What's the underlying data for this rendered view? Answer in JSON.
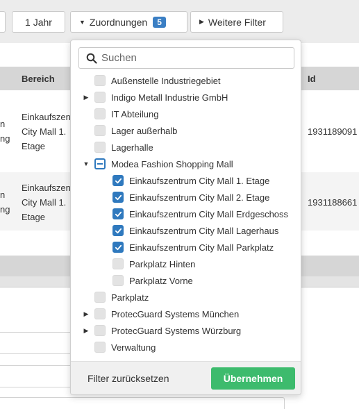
{
  "toolbar": {
    "year_label": "1 Jahr",
    "assignments_label": "Zuordnungen",
    "assignments_count": "5",
    "more_filters_label": "Weitere Filter"
  },
  "table": {
    "col_area": "Bereich",
    "col_id": "Id",
    "rows": [
      {
        "left_frag_1": "n",
        "left_frag_2": "ng",
        "area_1": "Einkaufszen",
        "area_2": "City Mall 1.",
        "area_3": "Etage",
        "id": "1931189091"
      },
      {
        "left_frag_1": "n",
        "left_frag_2": "ng",
        "area_1": "Einkaufszen",
        "area_2": "City Mall 1.",
        "area_3": "Etage",
        "id": "1931188661"
      }
    ]
  },
  "dropdown": {
    "search_placeholder": "Suchen",
    "items": [
      {
        "label": "Außenstelle Industriegebiet",
        "state": "unchecked",
        "level": 0,
        "toggle": ""
      },
      {
        "label": "Indigo Metall Industrie GmbH",
        "state": "unchecked",
        "level": 0,
        "toggle": "collapsed"
      },
      {
        "label": "IT Abteilung",
        "state": "unchecked",
        "level": 0,
        "toggle": ""
      },
      {
        "label": "Lager außerhalb",
        "state": "unchecked",
        "level": 0,
        "toggle": ""
      },
      {
        "label": "Lagerhalle",
        "state": "unchecked",
        "level": 0,
        "toggle": ""
      },
      {
        "label": "Modea Fashion Shopping Mall",
        "state": "partial",
        "level": 0,
        "toggle": "expanded"
      },
      {
        "label": "Einkaufszentrum City Mall 1. Etage",
        "state": "checked",
        "level": 1,
        "toggle": ""
      },
      {
        "label": "Einkaufszentrum City Mall 2. Etage",
        "state": "checked",
        "level": 1,
        "toggle": ""
      },
      {
        "label": "Einkaufszentrum City Mall Erdgeschoss",
        "state": "checked",
        "level": 1,
        "toggle": ""
      },
      {
        "label": "Einkaufszentrum City Mall Lagerhaus",
        "state": "checked",
        "level": 1,
        "toggle": ""
      },
      {
        "label": "Einkaufszentrum City Mall Parkplatz",
        "state": "checked",
        "level": 1,
        "toggle": ""
      },
      {
        "label": "Parkplatz Hinten",
        "state": "unchecked",
        "level": 1,
        "toggle": ""
      },
      {
        "label": "Parkplatz Vorne",
        "state": "unchecked",
        "level": 1,
        "toggle": ""
      },
      {
        "label": "Parkplatz",
        "state": "unchecked",
        "level": 0,
        "toggle": ""
      },
      {
        "label": "ProtecGuard Systems München",
        "state": "unchecked",
        "level": 0,
        "toggle": "collapsed"
      },
      {
        "label": "ProtecGuard Systems Würzburg",
        "state": "unchecked",
        "level": 0,
        "toggle": "collapsed"
      },
      {
        "label": "Verwaltung",
        "state": "unchecked",
        "level": 0,
        "toggle": ""
      }
    ],
    "reset_label": "Filter zurücksetzen",
    "apply_label": "Übernehmen"
  },
  "colors": {
    "badge": "#3b7fc4",
    "checkbox_checked": "#2f79be",
    "apply_button": "#3dbb6d"
  }
}
